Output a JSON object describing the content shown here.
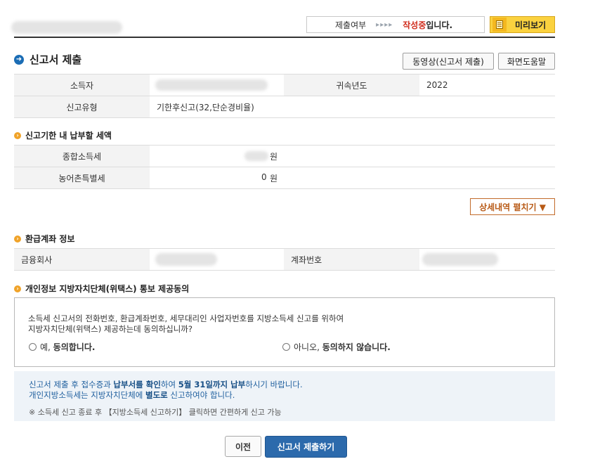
{
  "header": {
    "status_label": "제출여부",
    "status_arrows": "▸▸▸▸",
    "status_value": "작성중",
    "status_suffix": "입니다.",
    "preview_button": "미리보기"
  },
  "section": {
    "title": "신고서 제출",
    "video_button": "동영상(신고서 제출)",
    "help_button": "화면도움말"
  },
  "basic_info": {
    "taxpayer_label": "소득자",
    "year_label": "귀속년도",
    "year_value": "2022",
    "report_type_label": "신고유형",
    "report_type_value": "기한후신고(32,단순경비율)"
  },
  "tax_due": {
    "title": "신고기한 내 납부할 세액",
    "rows": [
      {
        "label": "종합소득세",
        "value": "",
        "unit": "원"
      },
      {
        "label": "농어촌특별세",
        "value": "0",
        "unit": "원"
      }
    ],
    "detail_button": "상세내역 펼치기 ▼"
  },
  "refund": {
    "title": "환급계좌 정보",
    "bank_label": "금융회사",
    "account_label": "계좌번호"
  },
  "consent": {
    "title": "개인정보 지방자치단체(위택스) 통보 제공동의",
    "line1": "소득세 신고서의 전화번호, 환급계좌번호, 세무대리인 사업자번호를 지방소득세 신고를 위하여",
    "line2": "지방자치단체(위택스) 제공하는데 동의하십니까?",
    "yes_prefix": "예, ",
    "yes_bold": "동의합니다.",
    "no_prefix": "아니오, ",
    "no_bold": "동의하지 않습니다."
  },
  "notice": {
    "l1_a": "신고서 제출 후 접수증과 ",
    "l1_b": "납부서를 확인",
    "l1_c": "하여 ",
    "l1_d": "5월 31일까지 납부",
    "l1_e": "하시기 바랍니다.",
    "l2_a": "개인지방소득세는 지방자치단체에 ",
    "l2_b": "별도로",
    "l2_c": " 신고하여야 합니다.",
    "l3": "※ 소득세 신고 종료 후 【지방소득세 신고하기】 클릭하면 간편하게 신고 가능"
  },
  "footer": {
    "prev_button": "이전",
    "submit_button": "신고서 제출하기"
  },
  "colors": {
    "status": "#d12e1e",
    "preview": "#fbd23f",
    "primary": "#2c6aac",
    "notice_bg": "#eef3f8"
  }
}
